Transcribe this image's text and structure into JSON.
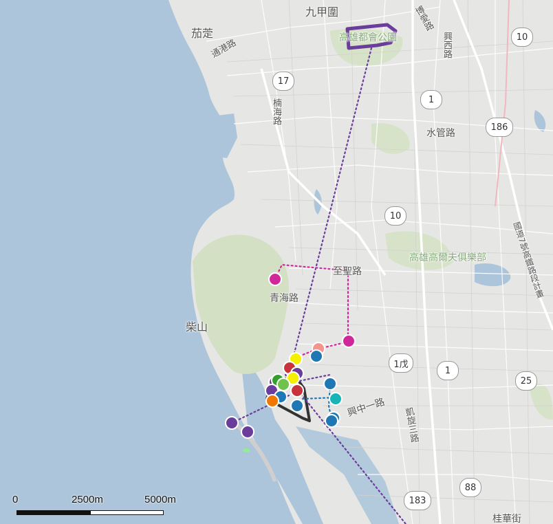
{
  "map": {
    "labels": {
      "jiajia": "九甲圍",
      "jiading": "茄萣",
      "tonggang": "通港路",
      "park": "高雄都會公園",
      "xingxi": "興西路",
      "nanhai": "楠海路",
      "shuiguan": "水管路",
      "chaishan": "柴山",
      "qinghai": "青海路",
      "zhisheng": "至聖路",
      "club": "高雄高爾夫俱樂部",
      "freeway": "國道7號高鐵路段計畫",
      "xingzhong": "興中一路",
      "kaixuan": "凱旋三路",
      "guihua": "桂華街",
      "wuguang": "博愛路"
    },
    "shields": {
      "r17": "17",
      "r1": "1",
      "r10a": "10",
      "r10b": "10",
      "r186": "186",
      "r1s": "1",
      "r1wu": "1戊",
      "r25": "25",
      "r183": "183",
      "r88": "88"
    },
    "colors": {
      "water": "#adc5da",
      "land": "#e8e8e6",
      "green": "#d3e0c4",
      "route_purple": "#6a3d9a",
      "route_magenta": "#d0289a",
      "route_blue": "#1f78b4"
    }
  },
  "scale": {
    "t0": "0",
    "t1": "2500m",
    "t2": "5000m"
  }
}
